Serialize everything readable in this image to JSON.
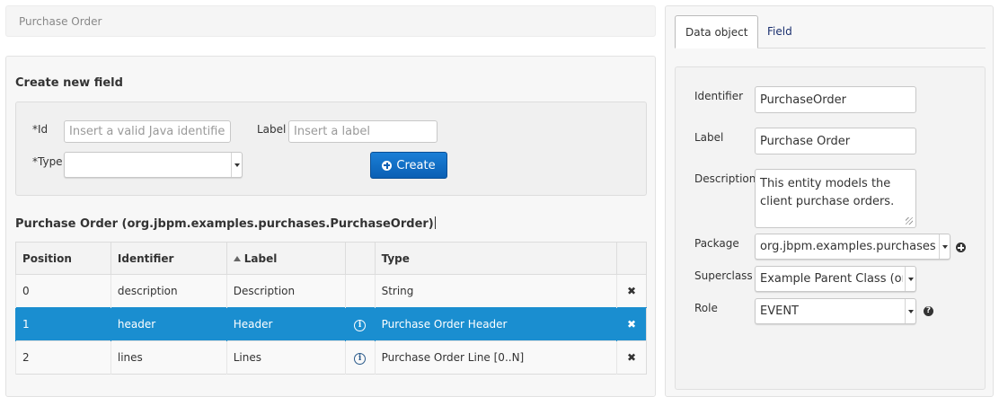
{
  "breadcrumb": {
    "title": "Purchase Order"
  },
  "create_field": {
    "title": "Create new field",
    "id_label": "*Id",
    "id_placeholder": "Insert a valid Java identifier",
    "label_label": "Label",
    "label_placeholder": "Insert a label",
    "type_label": "*Type",
    "type_value": "",
    "create_button": "Create"
  },
  "object": {
    "title": "Purchase Order (org.jbpm.examples.purchases.PurchaseOrder)"
  },
  "fields_table": {
    "columns": [
      "Position",
      "Identifier",
      "Label",
      "",
      "Type",
      ""
    ],
    "rows": [
      {
        "position": "0",
        "identifier": "description",
        "label": "Description",
        "type": "String",
        "has_info": false,
        "selected": false
      },
      {
        "position": "1",
        "identifier": "header",
        "label": "Header",
        "type": "Purchase Order Header",
        "has_info": true,
        "selected": true
      },
      {
        "position": "2",
        "identifier": "lines",
        "label": "Lines",
        "type": "Purchase Order Line [0..N]",
        "has_info": true,
        "selected": false
      }
    ],
    "delete_glyph": "✖",
    "info_glyph": "i"
  },
  "properties": {
    "tabs": [
      {
        "label": "Data object",
        "active": true
      },
      {
        "label": "Field",
        "active": false
      }
    ],
    "identifier_label": "Identifier",
    "identifier_value": "PurchaseOrder",
    "label_label": "Label",
    "label_value": "Purchase Order",
    "description_label": "Description",
    "description_value": "This entity models the client purchase orders.",
    "package_label": "Package",
    "package_value": "org.jbpm.examples.purchases",
    "superclass_label": "Superclass",
    "superclass_value": "Example Parent Class (or",
    "role_label": "Role",
    "role_value": "EVENT",
    "help_glyph": "?"
  },
  "colors": {
    "accent": "#0a5fb4",
    "selected_row": "#1a8ed0",
    "link": "#1a2f6e"
  }
}
